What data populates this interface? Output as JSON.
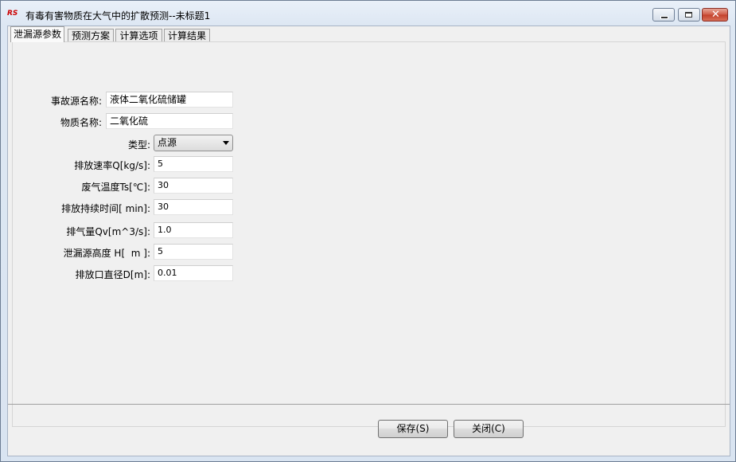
{
  "window": {
    "title": "有毒有害物质在大气中的扩散预测--未标题1",
    "icon_text": "RS",
    "controls": {
      "minimize": "minimize-icon",
      "maximize": "maximize-icon",
      "close_glyph": "✕"
    }
  },
  "tabs": [
    {
      "label": "泄漏源参数",
      "active": true
    },
    {
      "label": "预测方案",
      "active": false
    },
    {
      "label": "计算选项",
      "active": false
    },
    {
      "label": "计算结果",
      "active": false
    }
  ],
  "form": {
    "source_name": {
      "label": "事故源名称:",
      "value": "液体二氧化硫储罐"
    },
    "substance_name": {
      "label": "物质名称:",
      "value": "二氧化硫"
    },
    "type": {
      "label": "类型:",
      "value": "点源"
    },
    "emission_rate": {
      "label": "排放速率Q[kg/s]:",
      "value": "5"
    },
    "gas_temperature": {
      "label": "废气温度Ts[℃]:",
      "value": "30"
    },
    "emission_duration": {
      "label": "排放持续时间[ min]:",
      "value": "30"
    },
    "gas_volume": {
      "label": "排气量Qv[m^3/s]:",
      "value": "1.0"
    },
    "source_height": {
      "label": "泄漏源高度 H[  m ]:",
      "value": "5"
    },
    "outlet_diameter": {
      "label": "排放口直径D[m]:",
      "value": "0.01"
    }
  },
  "buttons": {
    "save": "保存(S)",
    "close": "关闭(C)"
  }
}
